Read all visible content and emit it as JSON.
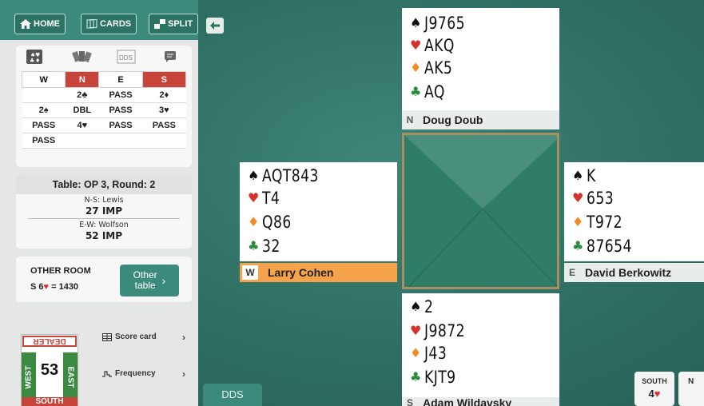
{
  "topbar": {
    "home_label": "HOME",
    "cards_label": "CARDS",
    "split_label": "SPLIT"
  },
  "bidding": {
    "tab_icons": [
      "tricks-icon",
      "cards-fan-icon",
      "dds-icon",
      "comment-icon"
    ],
    "dds_tab_label": "DDS",
    "headers": [
      "W",
      "N",
      "E",
      "S"
    ],
    "rows": [
      [
        "",
        "2♣",
        "PASS",
        "2♦"
      ],
      [
        "2♠",
        "DBL",
        "PASS",
        "3♥"
      ],
      [
        "PASS",
        "4♥",
        "PASS",
        "PASS"
      ],
      [
        "PASS",
        "",
        "",
        ""
      ]
    ]
  },
  "table_info": {
    "title": "Table: OP 3, Round: 2",
    "ns_label": "N-S: Lewis",
    "ns_score": "27 IMP",
    "ew_label": "E-W: Wolfson",
    "ew_score": "52 IMP"
  },
  "other_room": {
    "title": "OTHER ROOM",
    "contract_prefix": "S 6",
    "contract_suit": "♥",
    "result": " = 1430",
    "button_line1": "Other",
    "button_line2": "table"
  },
  "links": {
    "score_card": "Score card",
    "frequency": "Frequency"
  },
  "board": {
    "dealer_label": "DEALER",
    "west_label": "WEST",
    "east_label": "EAST",
    "south_label": "SOUTH",
    "number": "53"
  },
  "hands": {
    "north": {
      "dir": "N",
      "name": "Doug Doub",
      "spades": "J9765",
      "hearts": "AKQ",
      "diamonds": "AK5",
      "clubs": "AQ"
    },
    "west": {
      "dir": "W",
      "name": "Larry Cohen",
      "spades": "AQT843",
      "hearts": "T4",
      "diamonds": "Q86",
      "clubs": "32"
    },
    "east": {
      "dir": "E",
      "name": "David Berkowitz",
      "spades": "K",
      "hearts": "653",
      "diamonds": "T972",
      "clubs": "87654"
    },
    "south": {
      "dir": "S",
      "name": "Adam Wildavsky",
      "spades": "2",
      "hearts": "J9872",
      "diamonds": "J43",
      "clubs": "KJT9"
    }
  },
  "suits": {
    "spade": "♠",
    "heart": "♥",
    "diamond": "♦",
    "club": "♣"
  },
  "bottom": {
    "dds_label": "DDS",
    "contract_seat": "SOUTH",
    "contract_level": "4",
    "contract_suit": "♥",
    "next_seat_initial": "N"
  },
  "colors": {
    "felt": "#2e6e62",
    "accent": "#3b8a7b",
    "vulnerable": "#c7443a",
    "west_highlight": "#f5a24b",
    "frame": "#a78f62"
  }
}
